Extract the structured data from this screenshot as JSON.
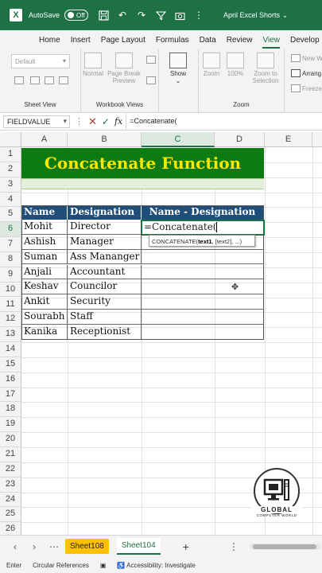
{
  "titlebar": {
    "autosave_label": "AutoSave",
    "autosave_state": "Off",
    "file_name": "April Excel Shorts",
    "file_chevron": "⌄"
  },
  "tabs": [
    "Home",
    "Insert",
    "Page Layout",
    "Formulas",
    "Data",
    "Review",
    "View",
    "Develop"
  ],
  "active_tab": "View",
  "ribbon": {
    "sheet_view": {
      "dropdown": "Default",
      "label": "Sheet View"
    },
    "workbook_views": {
      "normal": "Normal",
      "page_break_line1": "Page Break",
      "page_break_line2": "Preview",
      "label": "Workbook Views"
    },
    "show": {
      "label": "Show",
      "chevron": "⌄"
    },
    "zoom": {
      "zoom": "Zoom",
      "hundred": "100%",
      "zoom_sel_line1": "Zoom to",
      "zoom_sel_line2": "Selection",
      "label": "Zoom"
    },
    "window": {
      "new_window": "New W",
      "arrange": "Arrang",
      "freeze": "Freeze"
    }
  },
  "formula_bar": {
    "name_box": "FIELDVALUE",
    "formula": "=Concatenate(",
    "fx": "fx"
  },
  "columns": [
    "A",
    "B",
    "C",
    "D",
    "E"
  ],
  "rows": [
    "1",
    "2",
    "3",
    "4",
    "5",
    "6",
    "7",
    "8",
    "9",
    "10",
    "11",
    "12",
    "13",
    "14",
    "15",
    "16",
    "17",
    "18",
    "19",
    "20",
    "21",
    "22",
    "23",
    "24",
    "25",
    "26"
  ],
  "banner_title": "Concatenate Function",
  "table": {
    "headers": [
      "Name",
      "Designation",
      "Name - Designation"
    ],
    "rows": [
      [
        "Mohit",
        "Director"
      ],
      [
        "Ashish",
        "Manager"
      ],
      [
        "Suman",
        "Ass Mananger"
      ],
      [
        "Anjali",
        "Accountant"
      ],
      [
        "Keshav",
        "Councilor"
      ],
      [
        "Ankit",
        "Security"
      ],
      [
        "Sourabh",
        "Staff"
      ],
      [
        "Kanika",
        "Receptionist"
      ]
    ]
  },
  "active_cell_text": "=Concatenate(",
  "tooltip": {
    "fn": "CONCATENATE(",
    "arg1": "text1",
    "rest": ", [text2], ...)"
  },
  "logo": {
    "line1": "GLOBAL",
    "line2": "COMPUTER WORLD"
  },
  "sheets": [
    "Sheet108",
    "Sheet104"
  ],
  "statusbar": {
    "mode": "Enter",
    "circular": "Circular References",
    "accessibility": "Accessibility: Investigate"
  },
  "colors": {
    "excel_green": "#1e7145",
    "banner_bg": "#0e7a12",
    "banner_text": "#ffe600",
    "table_header": "#1f4e78",
    "sheet_tab_yellow": "#ffc000"
  }
}
